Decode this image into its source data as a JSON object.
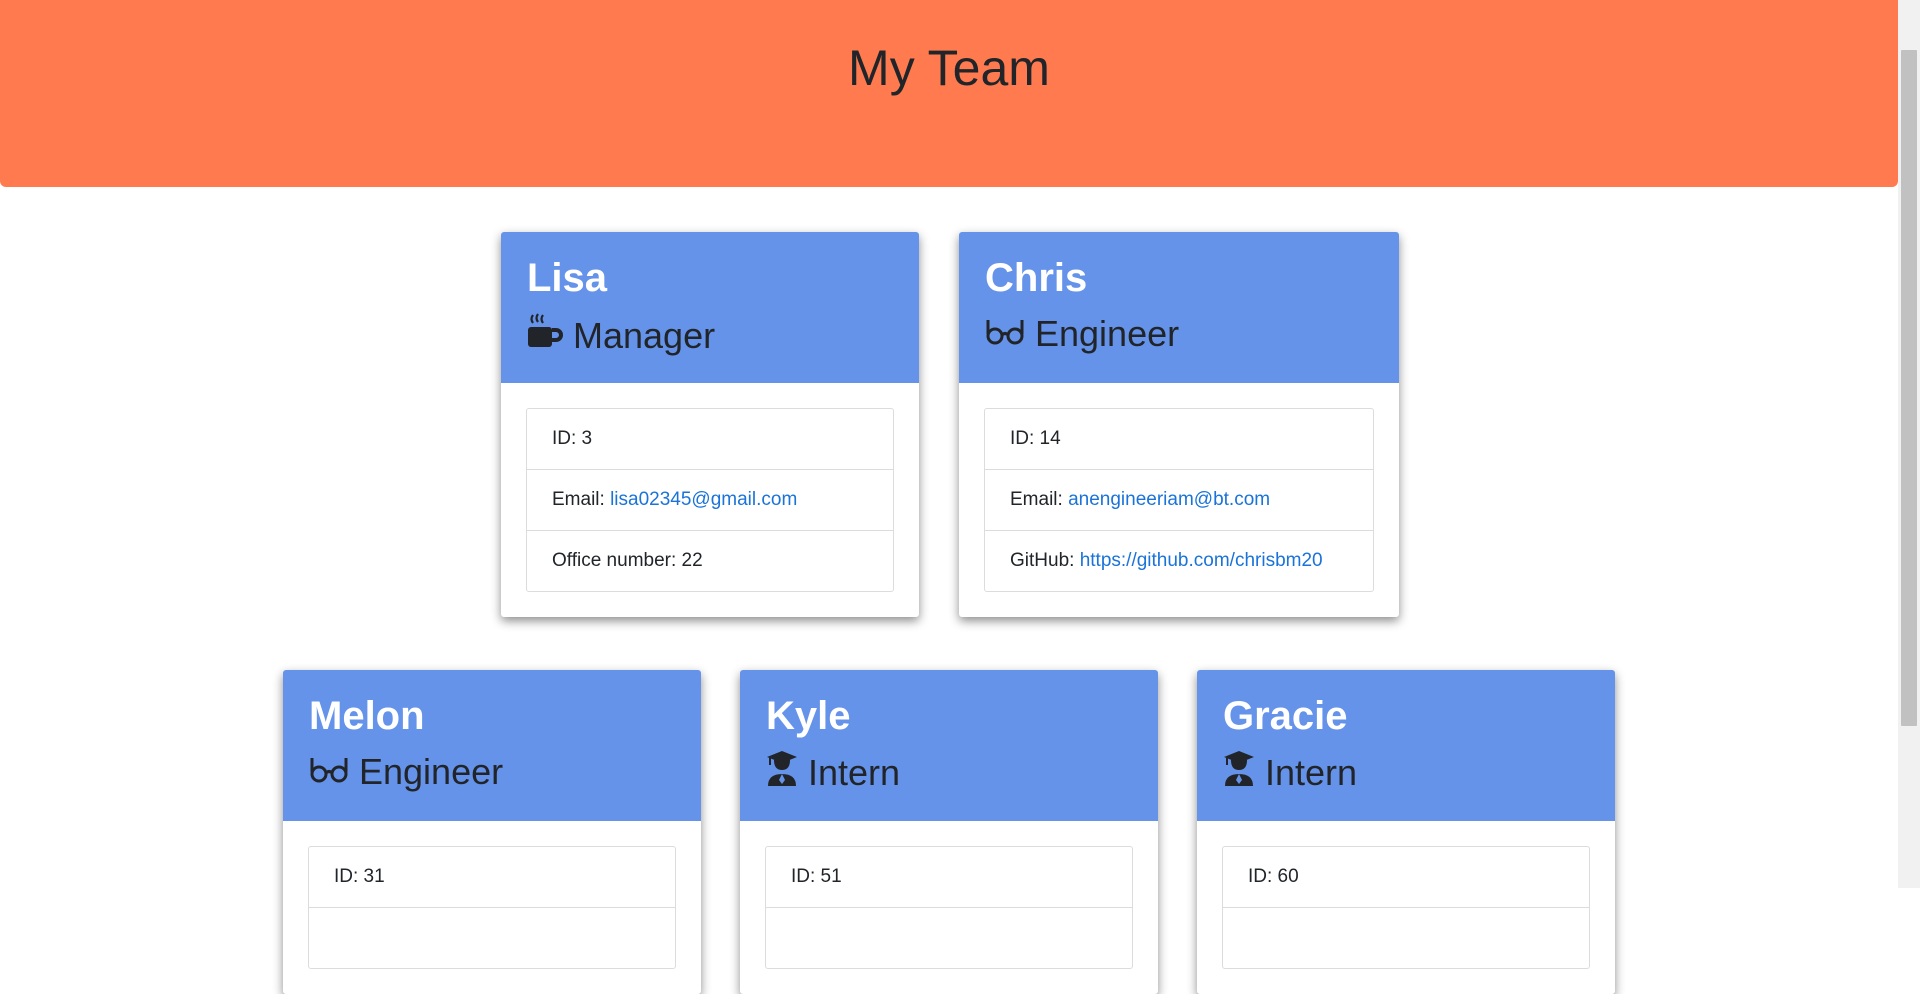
{
  "header": {
    "title": "My Team"
  },
  "cards": [
    {
      "name": "Lisa",
      "role": "Manager",
      "role_icon": "coffee-icon",
      "id_label": "ID: 3",
      "email_label": "Email:",
      "email": "lisa02345@gmail.com",
      "extra_label": "Office number: 22",
      "extra_link": ""
    },
    {
      "name": "Chris",
      "role": "Engineer",
      "role_icon": "glasses-icon",
      "id_label": "ID: 14",
      "email_label": "Email:",
      "email": "anengineeriam@bt.com",
      "extra_label": "GitHub:",
      "extra_link": "https://github.com/chrisbm20"
    },
    {
      "name": "Melon",
      "role": "Engineer",
      "role_icon": "glasses-icon",
      "id_label": "ID: 31"
    },
    {
      "name": "Kyle",
      "role": "Intern",
      "role_icon": "graduate-icon",
      "id_label": "ID: 51"
    },
    {
      "name": "Gracie",
      "role": "Intern",
      "role_icon": "graduate-icon",
      "id_label": "ID: 60"
    }
  ],
  "colors": {
    "header_bg": "#ff7b4f",
    "card_header_bg": "#6593e9",
    "link": "#1a73d9"
  }
}
